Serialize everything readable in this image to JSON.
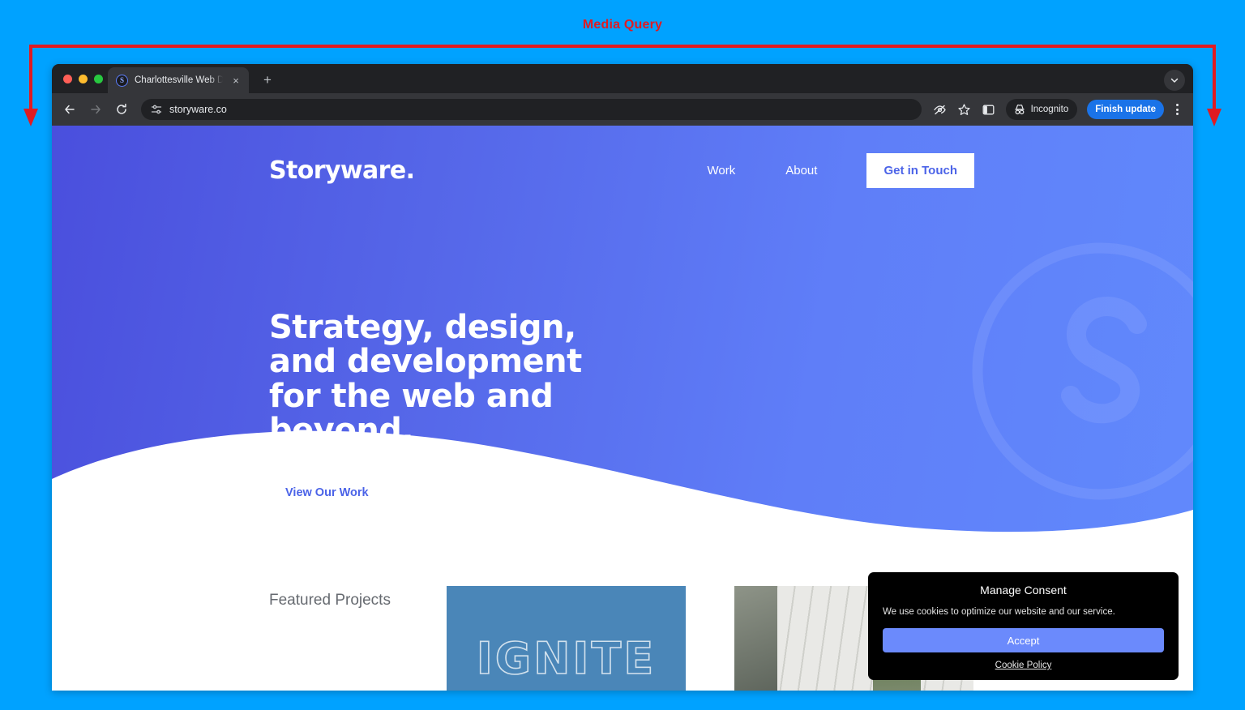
{
  "annotation": {
    "title": "Media Query",
    "color": "#e01b22"
  },
  "page_background_color": "#00a2ff",
  "browser": {
    "tab": {
      "favicon": "storyware-s-favicon",
      "title": "Charlottesville Web Design &",
      "close_label": "×"
    },
    "new_tab_label": "+",
    "tab_search_icon": "chevron-down-icon",
    "toolbar": {
      "back_icon": "back-arrow-icon",
      "forward_icon": "forward-arrow-icon",
      "reload_icon": "reload-icon",
      "site_settings_icon": "tune-icon",
      "url": "storyware.co",
      "tracking_icon": "eye-off-icon",
      "bookmark_icon": "star-icon",
      "side_panel_icon": "side-panel-icon",
      "incognito_icon": "incognito-hat-icon",
      "incognito_label": "Incognito",
      "update_label": "Finish update",
      "menu_icon": "kebab-menu-icon"
    }
  },
  "site": {
    "logo": "Storyware",
    "logo_period": ".",
    "nav": [
      {
        "label": "Work"
      },
      {
        "label": "About"
      }
    ],
    "cta_nav": "Get in Touch",
    "hero": {
      "title": "Strategy, design, and development for the web and beyond.",
      "cta": "View Our Work",
      "gradient_from": "#4a4fdd",
      "gradient_to": "#6189fc",
      "watermark_icon": "storyware-s-monogram"
    },
    "featured": {
      "heading": "Featured Projects",
      "projects": [
        {
          "name": "IGNITE",
          "type": "outlined-text-card",
          "color": "#4a86b8"
        },
        {
          "name": "aerial-cityscape-photo",
          "type": "photo-card",
          "color": "#6f7a6a"
        }
      ]
    }
  },
  "cookie_consent": {
    "title": "Manage Consent",
    "description": "We use cookies to optimize our website and our service.",
    "accept_label": "Accept",
    "policy_label": "Cookie Policy",
    "accent_color": "#6b8afc"
  }
}
